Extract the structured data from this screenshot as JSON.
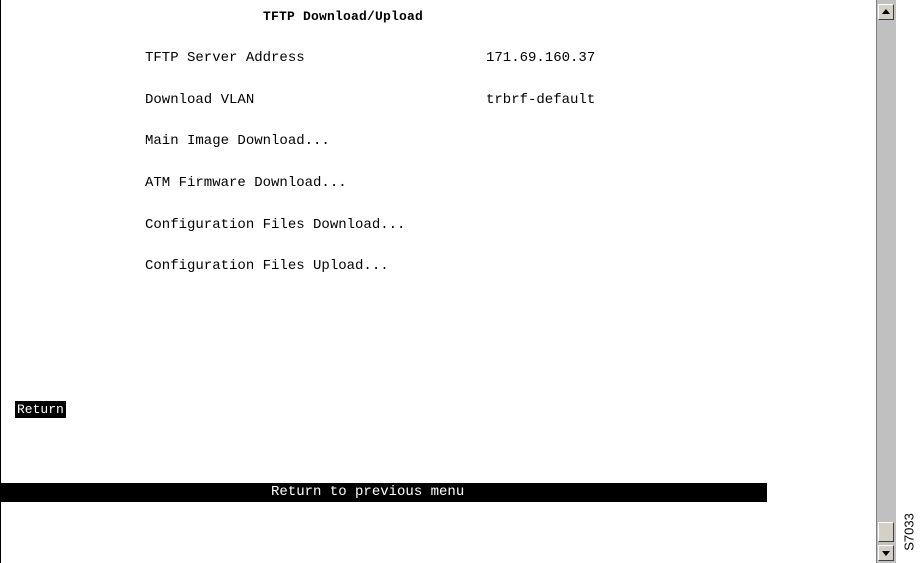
{
  "screen": {
    "title": "TFTP Download/Upload"
  },
  "menu": {
    "items": [
      {
        "label": "TFTP Server Address",
        "value": "171.69.160.37"
      },
      {
        "label": "Download VLAN",
        "value": "trbrf-default"
      },
      {
        "label": "Main Image Download..."
      },
      {
        "label": "ATM Firmware Download..."
      },
      {
        "label": "Configuration Files Download..."
      },
      {
        "label": "Configuration Files Upload..."
      }
    ],
    "return_label": "Return"
  },
  "status_bar": {
    "text": "Return to previous menu"
  },
  "scrollbar": {
    "up_icon": "arrow-up-icon",
    "down_icon": "arrow-down-icon"
  },
  "figure_id": "S7033"
}
